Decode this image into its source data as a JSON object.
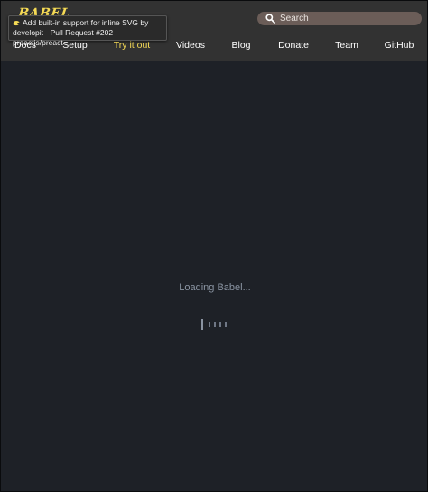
{
  "header": {
    "logo_text": "BABEL",
    "tooltip": {
      "icon": "babel-emoji-icon",
      "line1": "Add built-in support for inline SVG by",
      "line2": "developit · Pull Request #202 · preactjs/preact"
    },
    "search": {
      "placeholder": "Search"
    },
    "nav": [
      {
        "label": "Docs",
        "active": false
      },
      {
        "label": "Setup",
        "active": false
      },
      {
        "label": "Try it out",
        "active": true
      },
      {
        "label": "Videos",
        "active": false
      },
      {
        "label": "Blog",
        "active": false
      },
      {
        "label": "Donate",
        "active": false
      },
      {
        "label": "Team",
        "active": false
      },
      {
        "label": "GitHub",
        "active": false
      }
    ]
  },
  "main": {
    "loading_text": "Loading Babel..."
  },
  "colors": {
    "header_bg": "#323232",
    "accent": "#f5da55",
    "page_bg": "#1e2127",
    "search_bg": "#6b5d58",
    "loading_text": "#8b95a3"
  }
}
